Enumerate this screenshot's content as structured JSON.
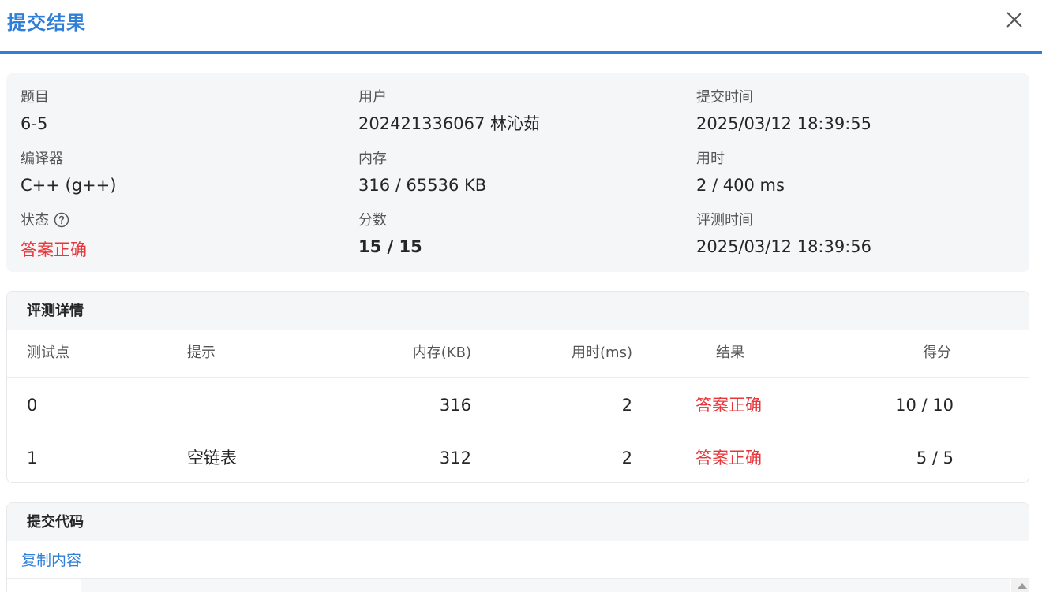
{
  "header": {
    "title": "提交结果"
  },
  "info": {
    "problem_label": "题目",
    "problem_value": "6-5",
    "user_label": "用户",
    "user_value": "202421336067 林沁茹",
    "submit_time_label": "提交时间",
    "submit_time_value": "2025/03/12 18:39:55",
    "compiler_label": "编译器",
    "compiler_value": "C++ (g++)",
    "memory_label": "内存",
    "memory_value": "316 / 65536 KB",
    "time_label": "用时",
    "time_value": "2 / 400 ms",
    "status_label": "状态",
    "status_value": "答案正确",
    "score_label": "分数",
    "score_value": "15 / 15",
    "judge_time_label": "评测时间",
    "judge_time_value": "2025/03/12 18:39:56"
  },
  "judge": {
    "title": "评测详情",
    "columns": [
      "测试点",
      "提示",
      "内存(KB)",
      "用时(ms)",
      "结果",
      "得分"
    ],
    "rows": [
      {
        "case": "0",
        "hint": "",
        "memory": "316",
        "time": "2",
        "result": "答案正确",
        "score": "10 / 10"
      },
      {
        "case": "1",
        "hint": "空链表",
        "memory": "312",
        "time": "2",
        "result": "答案正确",
        "score": "5 / 5"
      }
    ]
  },
  "code": {
    "title": "提交代码",
    "copy_label": "复制内容"
  },
  "colors": {
    "accent": "#2f7fd9",
    "success": "#e8363b"
  },
  "icons": {
    "close": "close-icon",
    "help": "question-circle-icon"
  }
}
